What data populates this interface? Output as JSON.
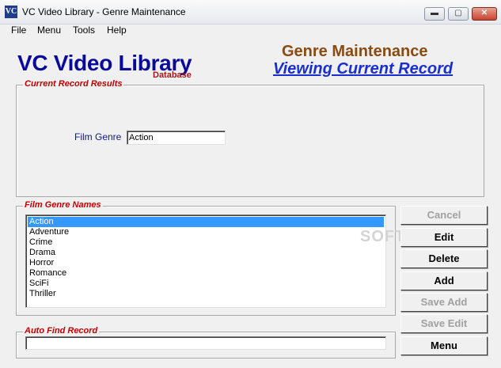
{
  "window": {
    "icon_text": "VC",
    "title": "VC Video Library - Genre Maintenance",
    "minimize_glyph": "▬",
    "maximize_glyph": "▢",
    "close_glyph": "✕"
  },
  "menu": {
    "items": [
      "File",
      "Menu",
      "Tools",
      "Help"
    ]
  },
  "header": {
    "app_name": "VC Video Library",
    "app_sub": "Database",
    "form_title": "Genre Maintenance",
    "form_mode": "Viewing Current Record"
  },
  "current_record": {
    "group_label": "Current Record Results",
    "field_label": "Film Genre",
    "field_value": "Action"
  },
  "genre_list": {
    "group_label": "Film Genre Names",
    "items": [
      "Action",
      "Adventure",
      "Crime",
      "Drama",
      "Horror",
      "Romance",
      "SciFi",
      "Thriller"
    ],
    "selected": "Action"
  },
  "auto_find": {
    "group_label": "Auto Find Record",
    "value": ""
  },
  "buttons": {
    "cancel": "Cancel",
    "edit": "Edit",
    "delete": "Delete",
    "add": "Add",
    "save_add": "Save Add",
    "save_edit": "Save Edit",
    "menu": "Menu"
  },
  "watermark": "SOFTPEDIA"
}
